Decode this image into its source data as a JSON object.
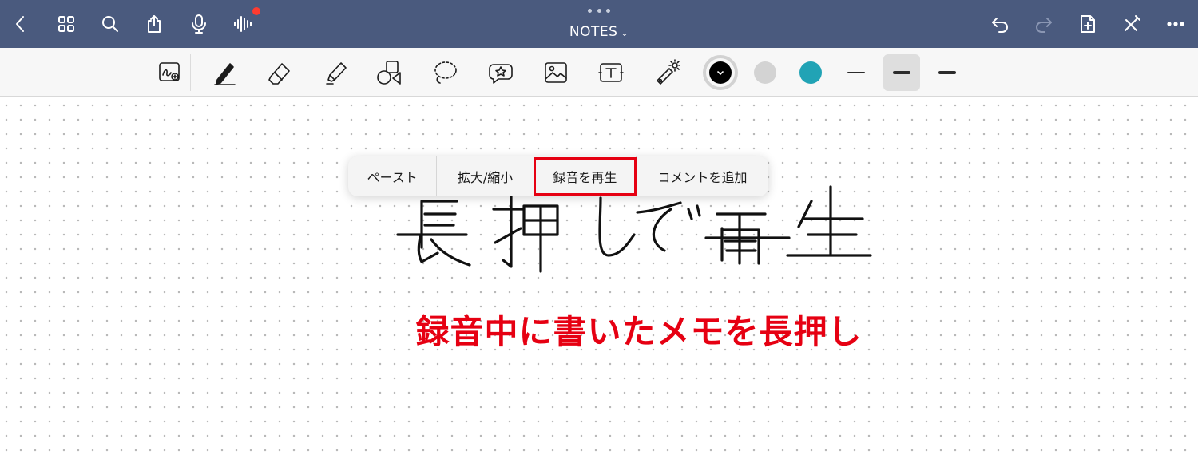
{
  "top_bar": {
    "title": "NOTES",
    "recording_indicator_color": "#ff3b30",
    "icons": [
      "back-icon",
      "grid-icon",
      "search-icon",
      "share-icon",
      "microphone-icon",
      "audio-waveform-icon",
      "undo-icon",
      "redo-icon",
      "new-page-icon",
      "close-draw-icon",
      "more-icon"
    ]
  },
  "toolbar": {
    "tools": [
      "zoom-window-icon",
      "pen-icon",
      "eraser-icon",
      "highlighter-icon",
      "shapes-icon",
      "lasso-icon",
      "elements-icon",
      "image-icon",
      "text-icon",
      "laser-pointer-icon"
    ],
    "colors": [
      "#000000",
      "#d3d3d3",
      "#21a3b5"
    ],
    "selected_color": "#000000",
    "stroke_widths": [
      "thin",
      "medium",
      "thick"
    ],
    "selected_stroke": "medium"
  },
  "context_menu": {
    "items": [
      "ペースト",
      "拡大/縮小",
      "録音を再生",
      "コメントを追加"
    ],
    "highlighted_index": 2,
    "highlight_color": "#e60012"
  },
  "handwritten_text": "長押しで再生",
  "caption": "録音中に書いたメモを長押し"
}
